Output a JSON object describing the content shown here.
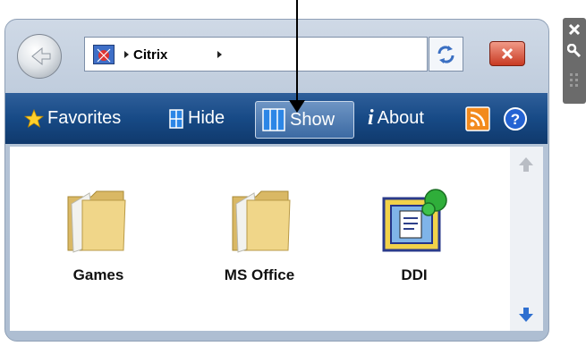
{
  "address_bar": {
    "segment": "Citrix"
  },
  "toolbar": {
    "favorites": "Favorites",
    "hide": "Hide",
    "show": "Show",
    "about": "About"
  },
  "items": [
    {
      "label": "Games",
      "icon": "folder-icon"
    },
    {
      "label": "MS Office",
      "icon": "folder-icon"
    },
    {
      "label": "DDI",
      "icon": "ddi-app-icon"
    }
  ],
  "colors": {
    "toolbar_bg": "#174a86",
    "accent_orange": "#f28a1d",
    "close_red": "#c83a22"
  }
}
